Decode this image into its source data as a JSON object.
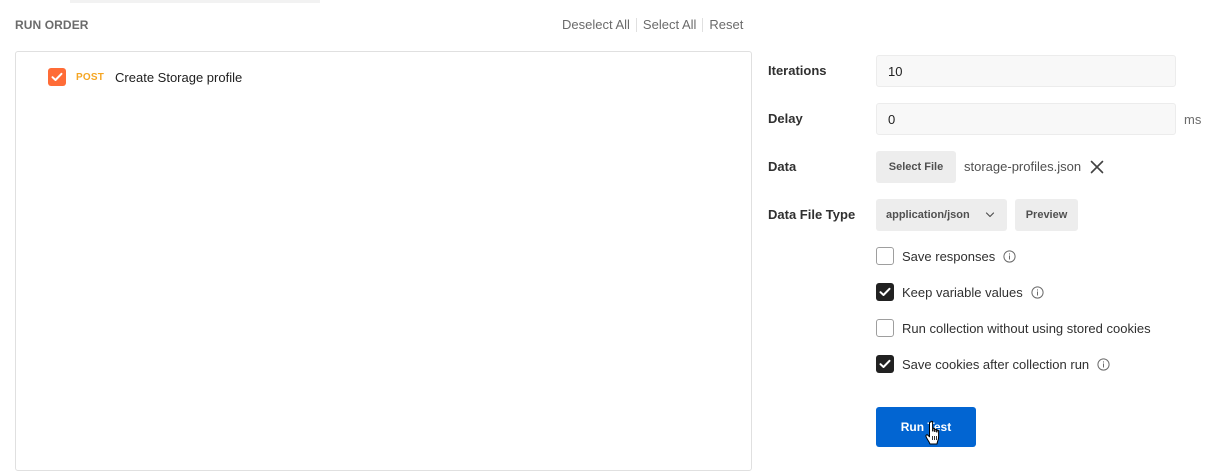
{
  "run_order": {
    "title": "RUN ORDER",
    "deselect_all": "Deselect All",
    "select_all": "Select All",
    "reset": "Reset"
  },
  "requests": [
    {
      "method": "POST",
      "name": "Create Storage profile",
      "checked": true
    }
  ],
  "settings": {
    "iterations_label": "Iterations",
    "iterations_value": "10",
    "delay_label": "Delay",
    "delay_value": "0",
    "delay_unit": "ms",
    "data_label": "Data",
    "select_file": "Select File",
    "file_name": "storage-profiles.json",
    "data_file_type_label": "Data File Type",
    "data_file_type_value": "application/json",
    "preview": "Preview"
  },
  "options": [
    {
      "label": "Save responses",
      "checked": false,
      "info": true
    },
    {
      "label": "Keep variable values",
      "checked": true,
      "info": true
    },
    {
      "label": "Run collection without using stored cookies",
      "checked": false,
      "info": false
    },
    {
      "label": "Save cookies after collection run",
      "checked": true,
      "info": true
    }
  ],
  "run_button": "Run Test",
  "colors": {
    "accent": "#ff6c37",
    "primary": "#0265d2",
    "method_post": "#f5a623"
  }
}
